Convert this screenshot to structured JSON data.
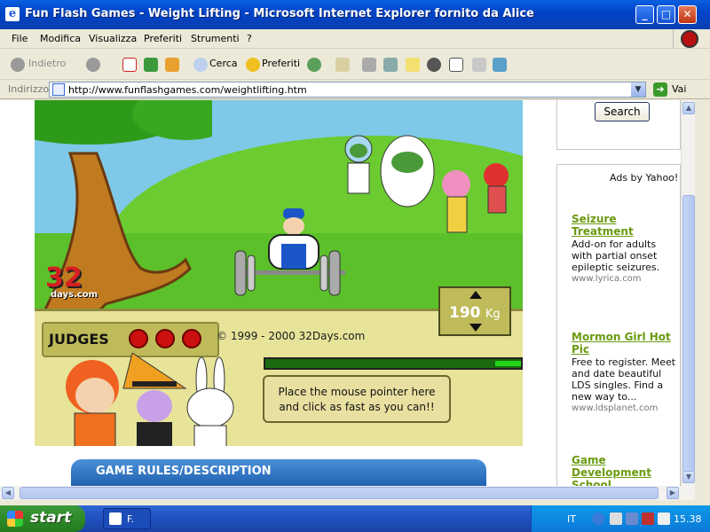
{
  "window": {
    "title": "Fun Flash Games - Weight Lifting - Microsoft Internet Explorer fornito da Alice"
  },
  "menu": [
    "File",
    "Modifica",
    "Visualizza",
    "Preferiti",
    "Strumenti",
    "?"
  ],
  "toolbar": {
    "back": "Indietro",
    "search": "Cerca",
    "favorites": "Preferiti"
  },
  "address": {
    "label": "Indirizzo",
    "url": "http://www.funflashgames.com/weightlifting.htm",
    "go": "Vai"
  },
  "game": {
    "judges_label": "JUDGES",
    "copyright": "© 1999 - 2000 32Days.com",
    "weight_value": "190",
    "weight_unit": "Kg",
    "instruction_line1": "Place the mouse pointer here",
    "instruction_line2": "and click as fast as you can!!",
    "logo_number": "32",
    "logo_text": "days.com",
    "power_fraction": 0.1
  },
  "section": {
    "rules_title": "GAME RULES/DESCRIPTION"
  },
  "sidebar": {
    "search_button": "Search",
    "ads_by": "Ads by Yahoo!",
    "ads": [
      {
        "title": "Seizure Treatment",
        "desc": "Add-on for adults with partial onset epileptic seizures.",
        "url": "www.lyrica.com"
      },
      {
        "title": "Mormon Girl Hot Pic",
        "desc": "Free to register. Meet and date beautiful LDS singles. Find a new way to...",
        "url": "www.ldsplanet.com"
      },
      {
        "title": "Game Development School",
        "desc": "",
        "url": ""
      }
    ]
  },
  "taskbar": {
    "start": "start",
    "task": "F.",
    "lang": "IT",
    "clock": "15.38"
  }
}
